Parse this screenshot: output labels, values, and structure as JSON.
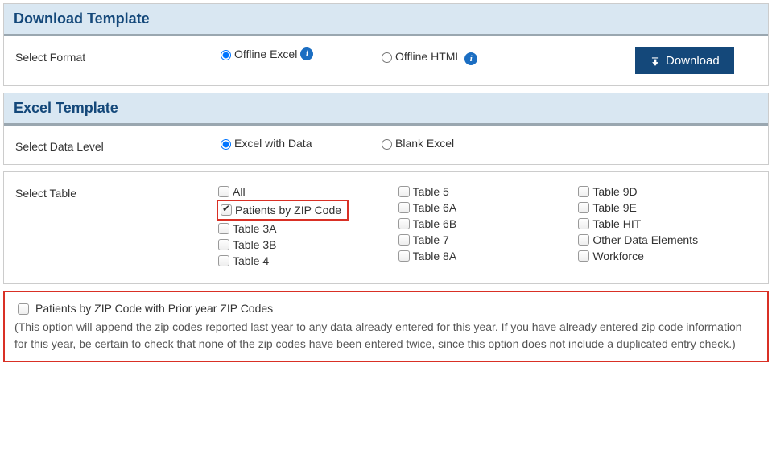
{
  "download": {
    "header": "Download Template",
    "select_format_label": "Select Format",
    "format_options": {
      "offline_excel": "Offline Excel",
      "offline_html": "Offline HTML"
    },
    "download_button": "Download"
  },
  "excel": {
    "header": "Excel Template",
    "select_data_level_label": "Select Data Level",
    "data_level_options": {
      "excel_with_data": "Excel with Data",
      "blank_excel": "Blank Excel"
    },
    "select_table_label": "Select Table",
    "tables": {
      "col1": [
        {
          "label": "All",
          "checked": false
        },
        {
          "label": "Patients by ZIP Code",
          "checked": true,
          "highlight": true
        },
        {
          "label": "Table 3A",
          "checked": false
        },
        {
          "label": "Table 3B",
          "checked": false
        },
        {
          "label": "Table 4",
          "checked": false
        }
      ],
      "col2": [
        {
          "label": "Table 5",
          "checked": false
        },
        {
          "label": "Table 6A",
          "checked": false
        },
        {
          "label": "Table 6B",
          "checked": false
        },
        {
          "label": "Table 7",
          "checked": false
        },
        {
          "label": "Table 8A",
          "checked": false
        }
      ],
      "col3": [
        {
          "label": "Table 9D",
          "checked": false
        },
        {
          "label": "Table 9E",
          "checked": false
        },
        {
          "label": "Table HIT",
          "checked": false
        },
        {
          "label": "Other Data Elements",
          "checked": false
        },
        {
          "label": "Workforce",
          "checked": false
        }
      ]
    }
  },
  "prior_year": {
    "checkbox_label": "Patients by ZIP Code with Prior year ZIP Codes",
    "note": "(This option will append the zip codes reported last year to any data already entered for this year. If you have already entered zip code information for this year, be certain to check that none of the zip codes have been entered twice, since this option does not include a duplicated entry check.)"
  }
}
